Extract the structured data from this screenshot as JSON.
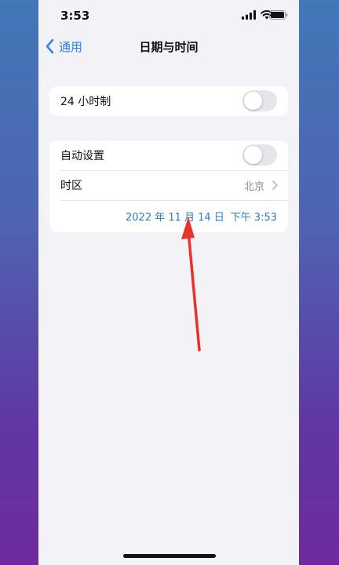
{
  "status_bar": {
    "time": "3:53"
  },
  "nav": {
    "back_label": "通用",
    "title": "日期与时间"
  },
  "settings": {
    "hour24_label": "24 小时制",
    "hour24_on": false,
    "auto_set_label": "自动设置",
    "auto_set_on": false,
    "timezone_label": "时区",
    "timezone_value": "北京",
    "date_value": "2022 年 11 月 14 日",
    "time_value": "下午 3:53"
  },
  "colors": {
    "accent": "#2f7ff6",
    "date_text": "#2f7bc4",
    "annotation_arrow": "#e8322d"
  },
  "icons": [
    "signal-icon",
    "wifi-icon",
    "battery-icon",
    "back-chevron-icon",
    "chevron-right-icon"
  ]
}
